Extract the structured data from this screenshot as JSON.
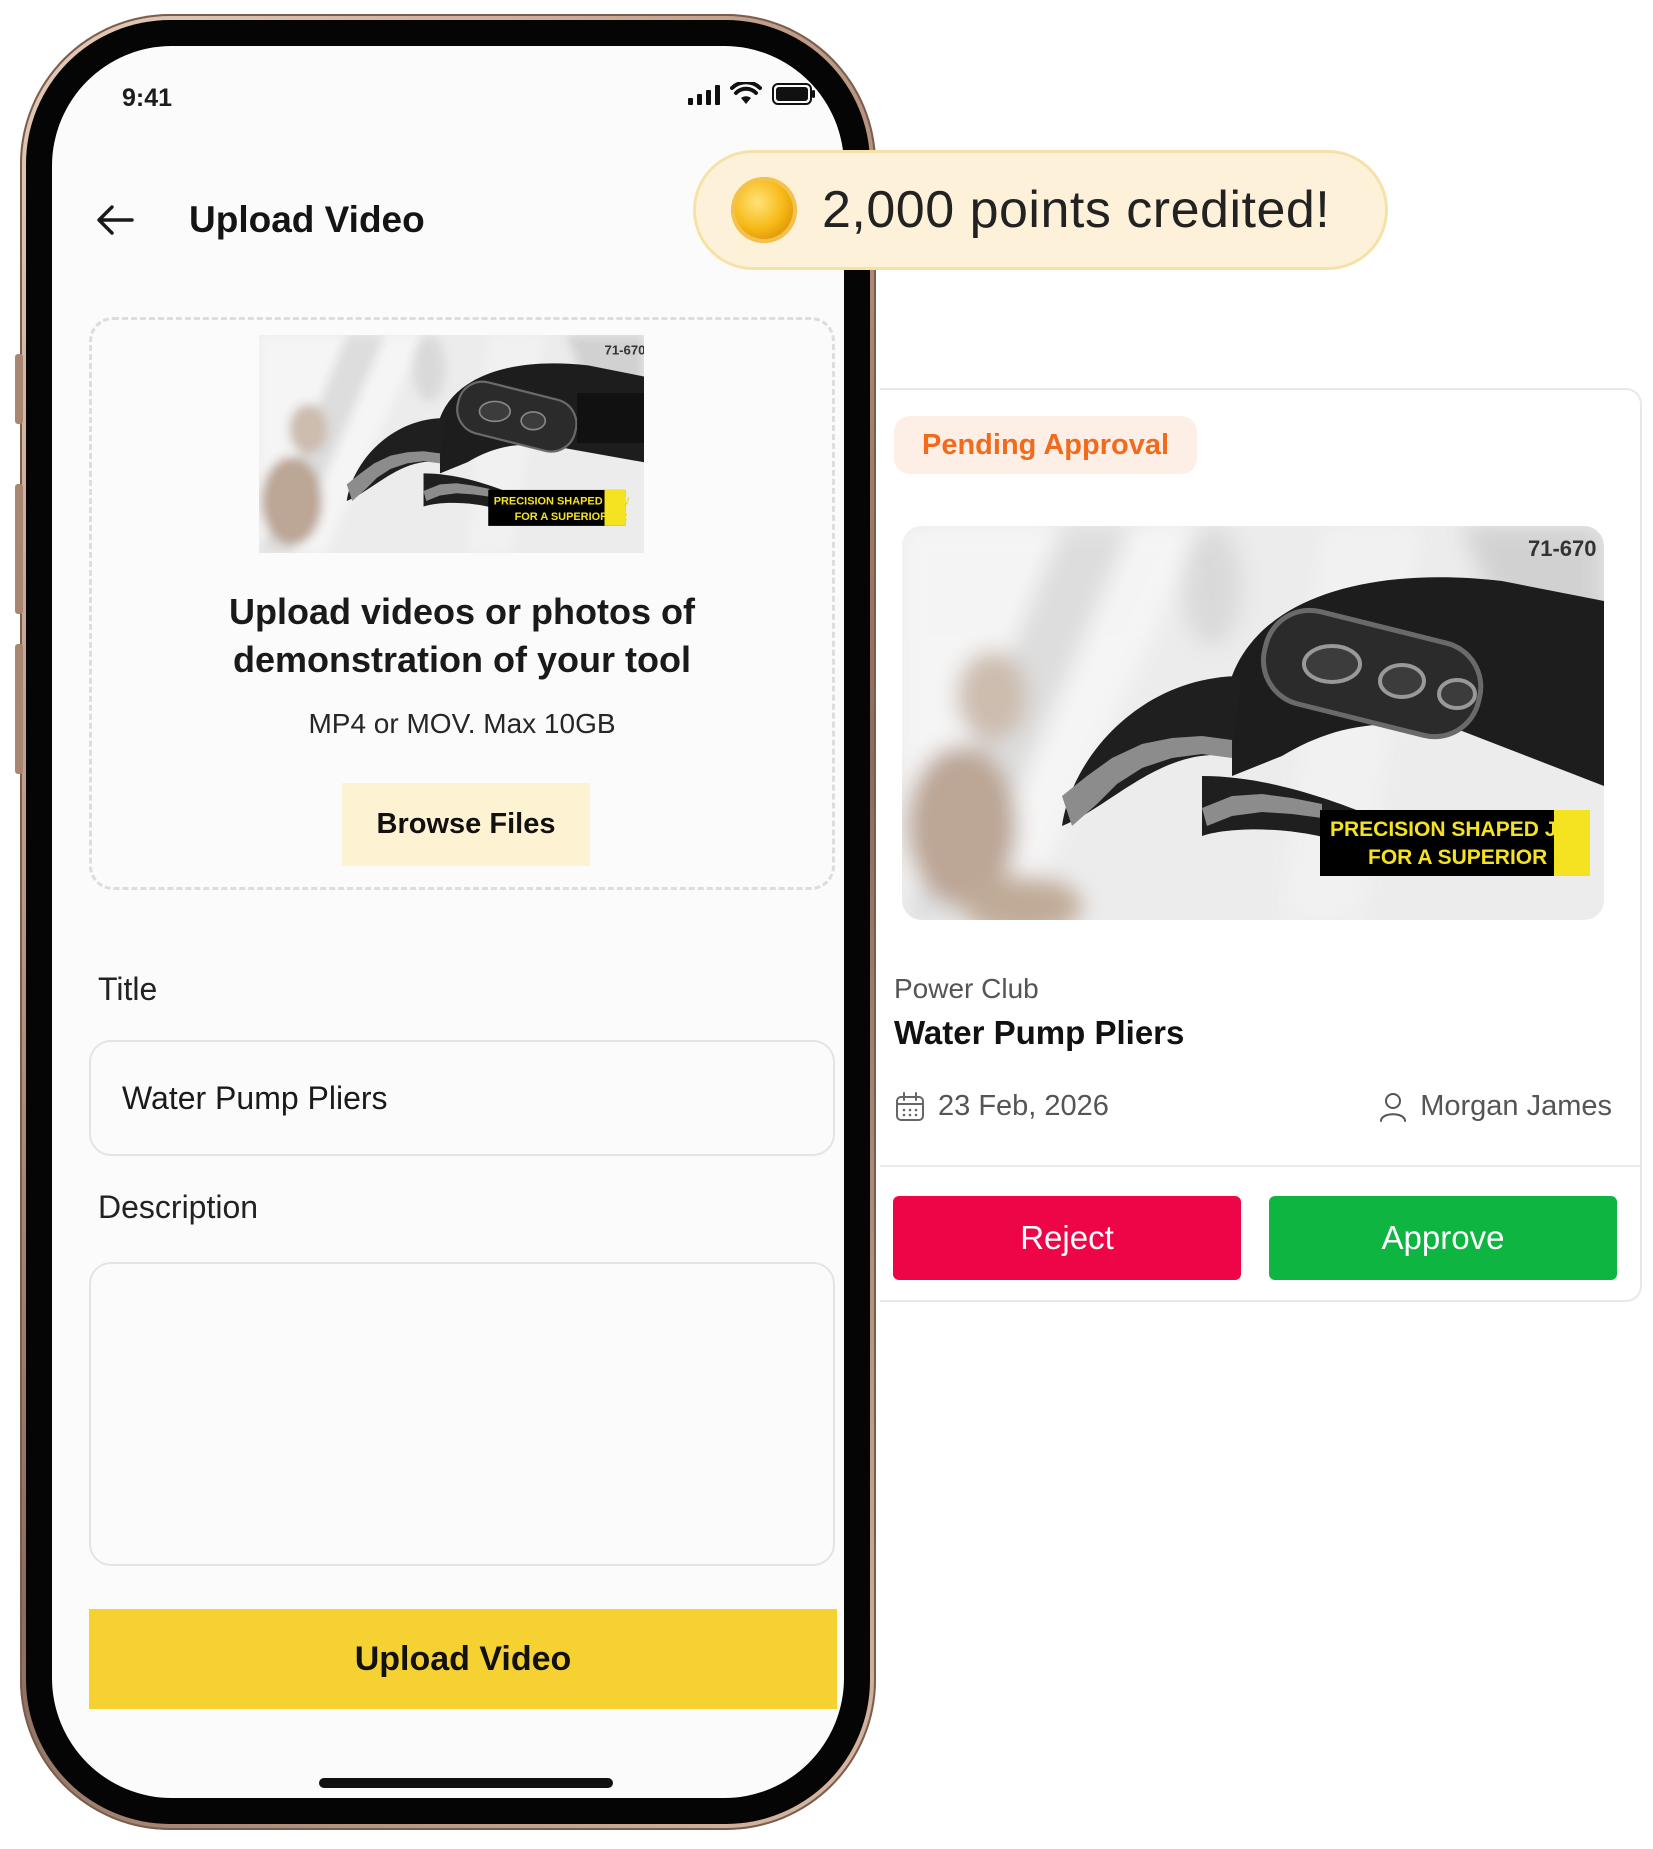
{
  "status_bar": {
    "time": "9:41"
  },
  "header": {
    "title": "Upload Video"
  },
  "product_image": {
    "model": "71-670",
    "caption_line1": "PRECISION SHAPED JAW",
    "caption_line2": "FOR A SUPERIOR GR"
  },
  "dropzone": {
    "heading_line1": "Upload videos or photos of",
    "heading_line2": "demonstration of your tool",
    "formats": "MP4 or MOV. Max 10GB",
    "browse_label": "Browse Files"
  },
  "form": {
    "title_label": "Title",
    "title_value": "Water Pump Pliers",
    "description_label": "Description",
    "description_value": "",
    "submit_label": "Upload Video"
  },
  "toast": {
    "message": "2,000 points credited!"
  },
  "review_card": {
    "status": "Pending Approval",
    "club": "Power Club",
    "title": "Water Pump Pliers",
    "date": "23 Feb, 2026",
    "author": "Morgan James",
    "reject_label": "Reject",
    "approve_label": "Approve"
  },
  "colors": {
    "primary_yellow": "#f5d132",
    "browse_bg": "#fdf3d2",
    "pending_text": "#f26b1d",
    "reject": "#ee0547",
    "approve": "#0fb541"
  },
  "icons": [
    "back-arrow-icon",
    "signal-icon",
    "wifi-icon",
    "battery-icon",
    "coin-icon",
    "calendar-icon",
    "user-icon"
  ]
}
